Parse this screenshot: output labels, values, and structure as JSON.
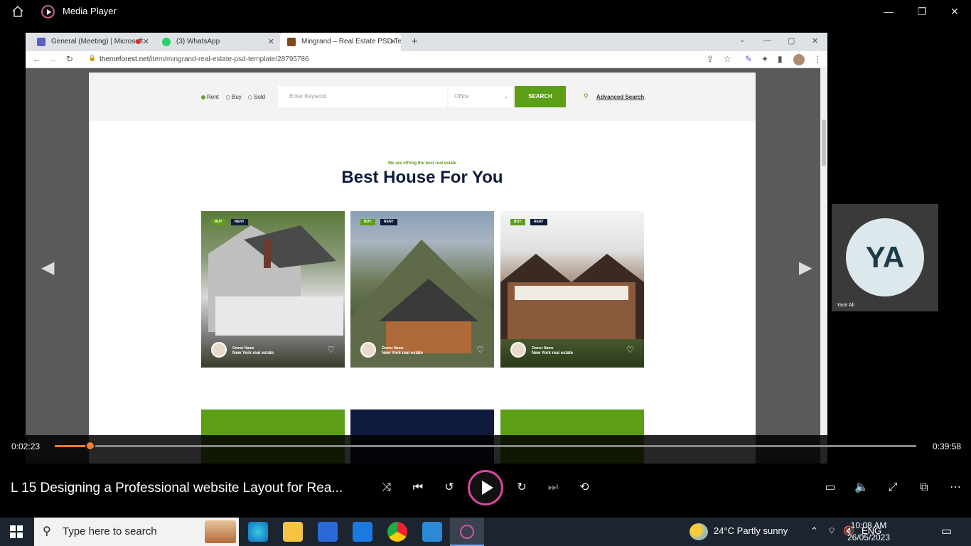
{
  "app": {
    "title": "Media Player"
  },
  "browser": {
    "tabs": [
      {
        "label": "General (Meeting) | Microsoft"
      },
      {
        "label": "(3) WhatsApp"
      },
      {
        "label": "Mingrand – Real Estate PSD Tem"
      }
    ],
    "url_domain": "themeforest.net",
    "url_path": "/item/mingrand-real-estate-psd-template/28795786"
  },
  "site": {
    "radios": [
      "Rent",
      "Buy",
      "Sold"
    ],
    "keyword_placeholder": "Enter Keyword",
    "select_value": "Office",
    "search_label": "SEARCH",
    "advanced_label": "Advanced Search",
    "subtitle": "We are offring the best real estate",
    "heading": "Best House For You",
    "cards": [
      {
        "badge1": "BUY",
        "badge2": "RENT",
        "owner": "Owner Name",
        "location": "New York real estate"
      },
      {
        "badge1": "BUY",
        "badge2": "RENT",
        "owner": "Owner Name",
        "location": "New York real estate"
      },
      {
        "badge1": "BUY",
        "badge2": "RENT",
        "owner": "Owner Name",
        "location": "New York real estate"
      }
    ]
  },
  "participant": {
    "initials": "YA",
    "name": "Yasir Ali"
  },
  "player": {
    "elapsed": "0:02:23",
    "duration": "0:39:58",
    "progress_fraction": 0.042,
    "video_title": "L 15 Designing a Professional website Layout for Rea..."
  },
  "taskbar": {
    "search_placeholder": "Type here to search",
    "weather": "24°C  Partly sunny",
    "lang": "ENG",
    "time": "10:08 AM",
    "date": "26/05/2023"
  },
  "colors": {
    "accent": "#5c9e16",
    "progress": "#ff7a2e",
    "navy": "#0f1b3c"
  }
}
